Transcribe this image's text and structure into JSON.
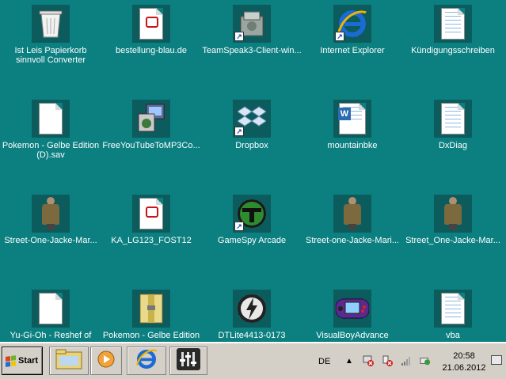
{
  "desktop": {
    "icons": [
      {
        "label": "Ist Leis Papierkorb sinnvoll Converter",
        "icon": "recycle-bin-icon"
      },
      {
        "label": "bestellung-blau.de",
        "icon": "pdf-file-icon"
      },
      {
        "label": "TeamSpeak3-Client-win...",
        "icon": "installer-icon"
      },
      {
        "label": "Internet Explorer",
        "icon": "internet-explorer-icon"
      },
      {
        "label": "Kündigungsschreiben",
        "icon": "text-file-icon"
      },
      {
        "label": "Pokemon - Gelbe Edition (D).sav",
        "icon": "blank-file-icon"
      },
      {
        "label": "FreeYouTubeToMP3Co...",
        "icon": "installer-icon"
      },
      {
        "label": "Dropbox",
        "icon": "dropbox-icon"
      },
      {
        "label": "mountainbke",
        "icon": "word-document-icon"
      },
      {
        "label": "DxDiag",
        "icon": "text-file-icon"
      },
      {
        "label": "Street-One-Jacke-Mar...",
        "icon": "image-file-icon"
      },
      {
        "label": "KA_LG123_FOST12",
        "icon": "pdf-file-icon"
      },
      {
        "label": "GameSpy Arcade",
        "icon": "gamespy-icon"
      },
      {
        "label": "Street-one-Jacke-Mari...",
        "icon": "image-file-icon"
      },
      {
        "label": "Street_One-Jacke-Mar...",
        "icon": "image-file-icon"
      },
      {
        "label": "Yu-Gi-Oh - Reshef of",
        "icon": "blank-file-icon"
      },
      {
        "label": "Pokemon - Gelbe Edition",
        "icon": "archive-file-icon"
      },
      {
        "label": "DTLite4413-0173",
        "icon": "daemon-tools-icon"
      },
      {
        "label": "VisualBoyAdvance",
        "icon": "gameboy-advance-icon"
      },
      {
        "label": "vba",
        "icon": "config-file-icon"
      }
    ]
  },
  "taskbar": {
    "start_label": "Start",
    "pinned": [
      {
        "icon": "file-explorer-icon"
      },
      {
        "icon": "media-player-icon"
      },
      {
        "icon": "internet-explorer-icon"
      },
      {
        "icon": "equalizer-app-icon"
      }
    ],
    "language": "DE",
    "tray_icons": [
      "show-hidden-icons-chevron",
      "network-error-icon",
      "action-center-error-icon",
      "signal-strength-icon",
      "power-status-icon"
    ],
    "time": "20:58",
    "date": "21.06.2012"
  },
  "colors": {
    "desktop_bg": "#0c7f80",
    "taskbar_bg": "#d4d0c8",
    "accent_ie": "#1b6bd6"
  }
}
